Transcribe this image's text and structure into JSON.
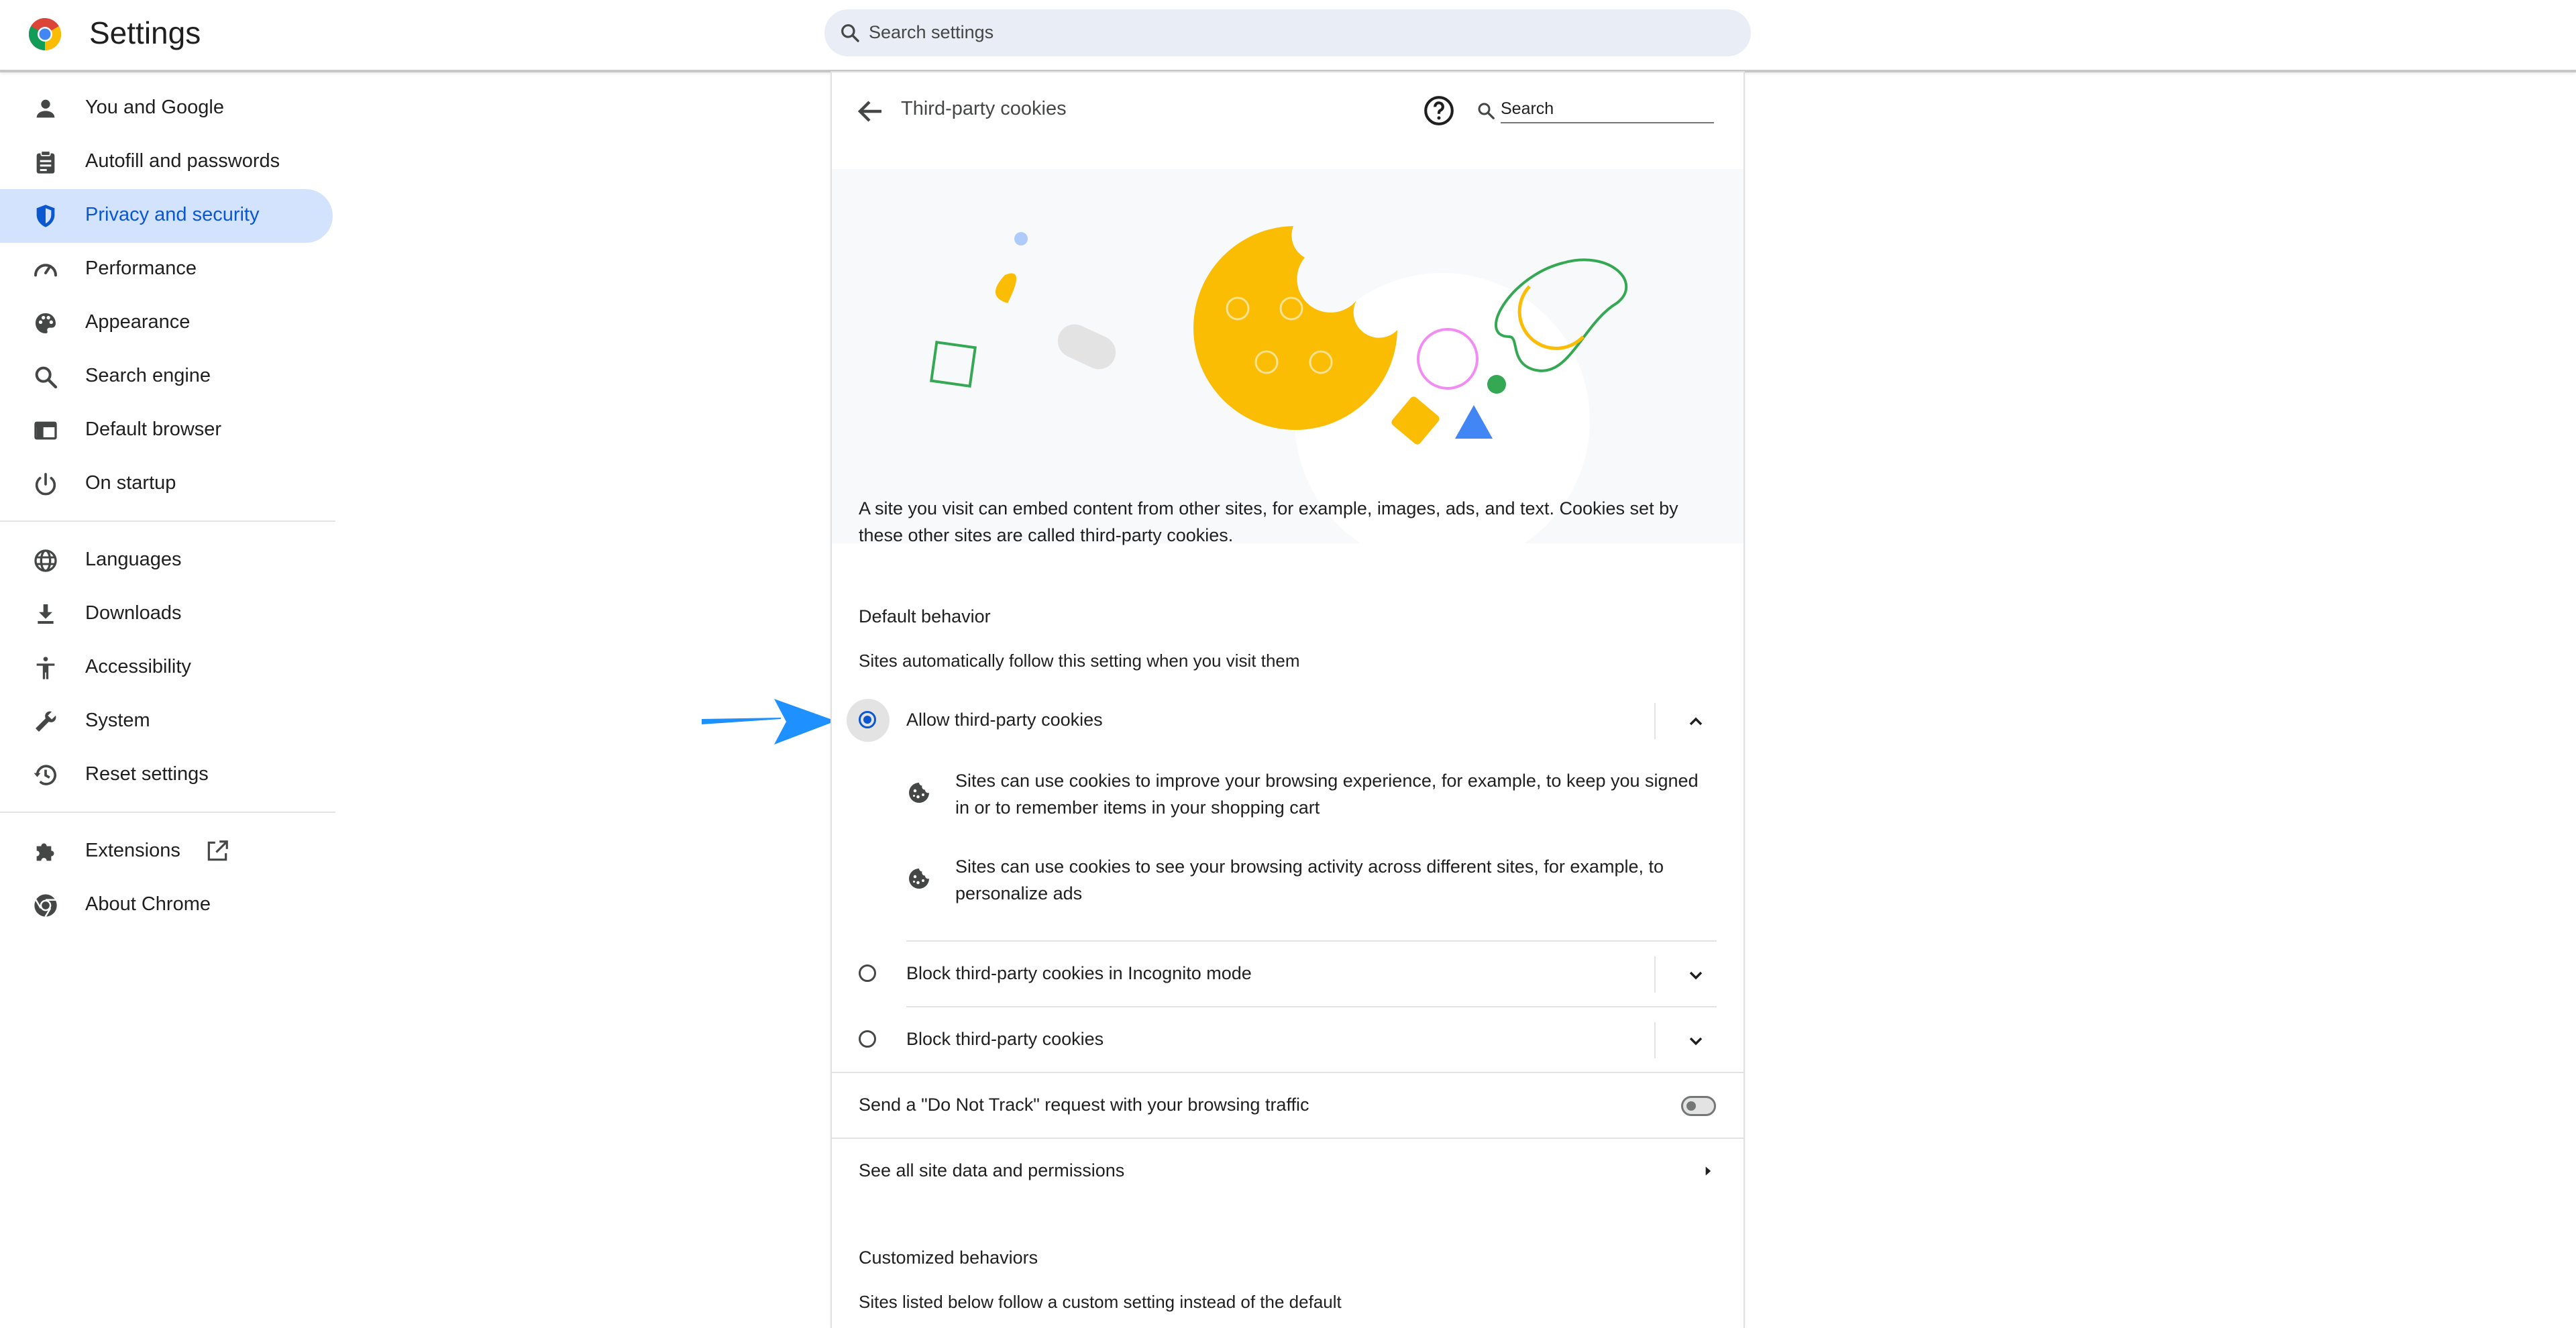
{
  "header": {
    "app_title": "Settings",
    "search_placeholder": "Search settings"
  },
  "sidebar": {
    "items": [
      {
        "label": "You and Google",
        "icon": "person-icon"
      },
      {
        "label": "Autofill and passwords",
        "icon": "clipboard-icon"
      },
      {
        "label": "Privacy and security",
        "icon": "shield-icon",
        "active": true
      },
      {
        "label": "Performance",
        "icon": "speedometer-icon"
      },
      {
        "label": "Appearance",
        "icon": "palette-icon"
      },
      {
        "label": "Search engine",
        "icon": "search-icon"
      },
      {
        "label": "Default browser",
        "icon": "browser-window-icon"
      },
      {
        "label": "On startup",
        "icon": "power-icon"
      },
      {
        "label": "Languages",
        "icon": "globe-icon"
      },
      {
        "label": "Downloads",
        "icon": "download-icon"
      },
      {
        "label": "Accessibility",
        "icon": "accessibility-icon"
      },
      {
        "label": "System",
        "icon": "wrench-icon"
      },
      {
        "label": "Reset settings",
        "icon": "history-icon"
      },
      {
        "label": "Extensions",
        "icon": "puzzle-icon"
      },
      {
        "label": "About Chrome",
        "icon": "chrome-icon"
      }
    ]
  },
  "page": {
    "title": "Third-party cookies",
    "search_placeholder": "Search",
    "description": "A site you visit can embed content from other sites, for example, images, ads, and text. Cookies set by these other sites are called third-party cookies.",
    "default_behavior": {
      "heading": "Default behavior",
      "subheading": "Sites automatically follow this setting when you visit them",
      "options": [
        {
          "label": "Allow third-party cookies",
          "selected": true,
          "expanded": true,
          "details": [
            "Sites can use cookies to improve your browsing experience, for example, to keep you signed in or to remember items in your shopping cart",
            "Sites can use cookies to see your browsing activity across different sites, for example, to personalize ads"
          ]
        },
        {
          "label": "Block third-party cookies in Incognito mode",
          "selected": false,
          "expanded": false
        },
        {
          "label": "Block third-party cookies",
          "selected": false,
          "expanded": false
        }
      ]
    },
    "do_not_track": {
      "label": "Send a \"Do Not Track\" request with your browsing traffic",
      "enabled": false
    },
    "site_data_link": "See all site data and permissions",
    "customized": {
      "heading": "Customized behaviors",
      "subheading": "Sites listed below follow a custom setting instead of the default"
    }
  },
  "colors": {
    "accent": "#0b57d0",
    "active_nav_bg": "#d3e3fd",
    "search_bg": "#e9eef6",
    "annotation_arrow": "#1e90ff",
    "cookie_yellow": "#fbbc04",
    "google_green": "#34a853",
    "google_blue": "#4285f4"
  }
}
